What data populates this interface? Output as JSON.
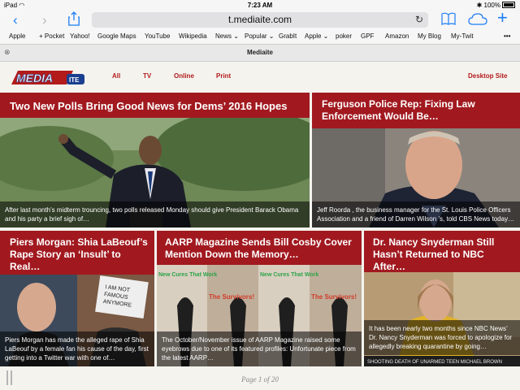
{
  "status": {
    "device": "iPad",
    "time": "7:23 AM",
    "battery": "100%"
  },
  "browser": {
    "url": "t.mediaite.com",
    "bookmarks": [
      "Apple",
      "+ Pocket",
      "Yahoo!",
      "Google Maps",
      "YouTube",
      "Wikipedia",
      "News ⌄",
      "Popular ⌄",
      "GrabIt",
      "Apple ⌄",
      "poker",
      "GPF",
      "Amazon",
      "My Blog",
      "My-Twit"
    ],
    "more": "•••",
    "tab_title": "Mediaite"
  },
  "site": {
    "logo_text": "MEDIA",
    "logo_badge": "ITE",
    "nav": [
      "All",
      "TV",
      "Online",
      "Print"
    ],
    "desktop_link": "Desktop Site"
  },
  "cards": [
    {
      "title": "Two New Polls Bring Good News for Dems’ 2016 Hopes",
      "caption": "After last month’s midterm trouncing, two polls released Monday should give President Barack Obama and his party a brief sigh of…"
    },
    {
      "title": "Ferguson Police Rep: Fixing Law Enforcement Would Be…",
      "caption": "Jeff Roorda , the business manager for the St. Louis Police Officers Association and a friend of Darren Wilson ’s, told CBS News today…"
    },
    {
      "title": "Piers Morgan: Shia LaBeouf’s Rape Story an ‘Insult’ to Real…",
      "caption": "Piers Morgan has made the alleged rape of Shia LaBeouf by a female fan his cause of the day, first getting into a Twitter war with one of…"
    },
    {
      "title": "AARP Magazine Sends Bill Cosby Cover Mention Down the Memory…",
      "caption": "The October/November issue of AARP Magazine raised some eyebrows due to one of its featured profiles: Unfortunate piece from the latest AARP…"
    },
    {
      "title": "Dr. Nancy Snyderman Still Hasn’t Returned to NBC After…",
      "caption": "It has been nearly two months since NBC News’ Dr. Nancy Snyderman was forced to apologize for allegedly breaking quarantine by going…"
    }
  ],
  "image_text": {
    "aarp_cover": "New Cures That Work",
    "aarp_cover_sub": "The Survivors!",
    "sign": "I AM NOT FAMOUS ANYMORE",
    "ticker": "SHOOTING DEATH OF UNARMED TEEN MICHAEL BROWN"
  },
  "footer": {
    "page": "Page 1 of 20"
  }
}
